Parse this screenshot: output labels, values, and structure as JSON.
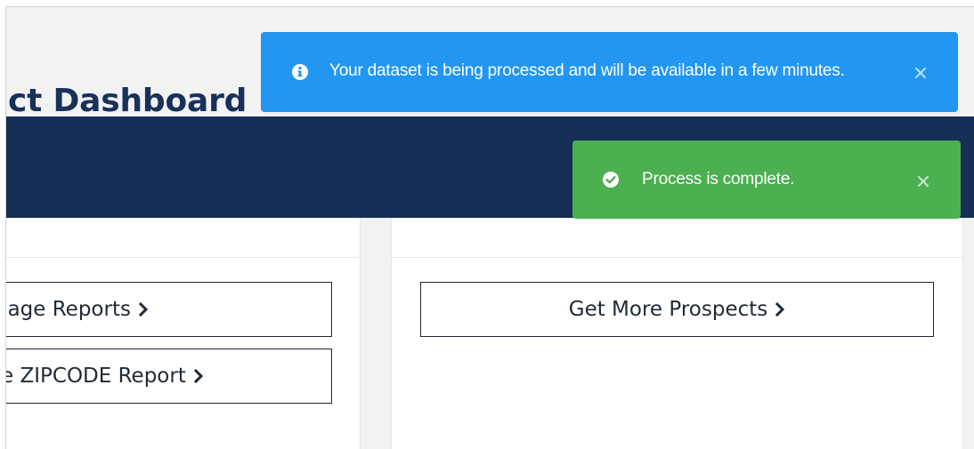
{
  "page": {
    "title": "ct Dashboard"
  },
  "left_panel": {
    "buttons": [
      {
        "label": "nage Reports"
      },
      {
        "label": "te ZIPCODE Report"
      }
    ]
  },
  "right_panel": {
    "buttons": [
      {
        "label": "Get More Prospects"
      }
    ]
  },
  "toasts": [
    {
      "type": "info",
      "icon": "info-circle-icon",
      "message": "Your dataset is being processed and will be available in a few minutes.",
      "color": "#2196f3"
    },
    {
      "type": "success",
      "icon": "check-circle-icon",
      "message": "Process is complete.",
      "color": "#4caf50"
    }
  ],
  "colors": {
    "navy": "#162f57",
    "title": "#17315a",
    "background": "#f2f2f3"
  }
}
